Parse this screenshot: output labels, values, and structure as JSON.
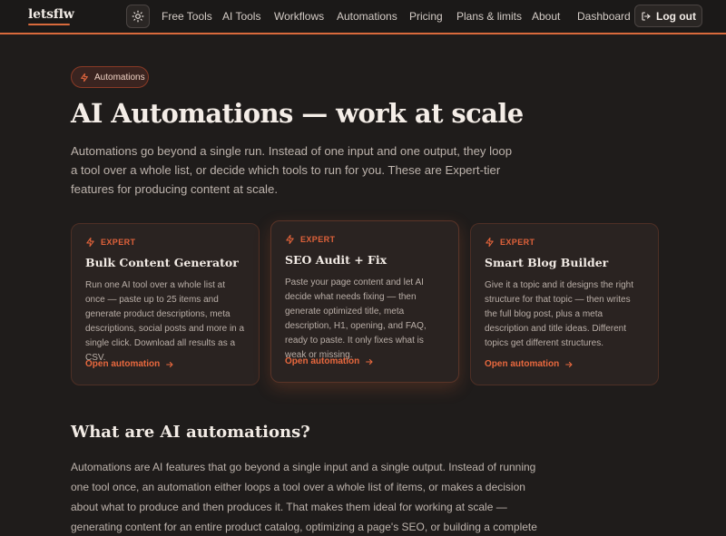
{
  "header": {
    "logo": "letsflw",
    "nav": [
      "Free Tools",
      "AI Tools",
      "Workflows",
      "Automations",
      "Pricing",
      "Plans & limits",
      "About",
      "Dashboard"
    ],
    "logout_label": "Log out"
  },
  "hero": {
    "badge": "Automations",
    "title": "AI Automations — work at scale",
    "lead": "Automations go beyond a single run. Instead of one input and one output, they loop a tool over a whole list, or decide which tools to run for you. These are Expert-tier features for producing content at scale."
  },
  "cards": [
    {
      "tag": "EXPERT",
      "title": "Bulk Content Generator",
      "text": "Run one AI tool over a whole list at once — paste up to 25 items and generate product descriptions, meta descriptions, social posts and more in a single click. Download all results as a CSV.",
      "link": "Open automation"
    },
    {
      "tag": "EXPERT",
      "title": "SEO Audit + Fix",
      "text": "Paste your page content and let AI decide what needs fixing — then generate optimized title, meta description, H1, opening, and FAQ, ready to paste. It only fixes what is weak or missing.",
      "link": "Open automation"
    },
    {
      "tag": "EXPERT",
      "title": "Smart Blog Builder",
      "text": "Give it a topic and it designs the right structure for that topic — then writes the full blog post, plus a meta description and title ideas. Different topics get different structures.",
      "link": "Open automation"
    }
  ],
  "section": {
    "title": "What are AI automations?",
    "body": "Automations are AI features that go beyond a single input and a single output. Instead of running one tool once, an automation either loops a tool over a whole list of items, or makes a decision about what to produce and then produces it. That makes them ideal for working at scale — generating content for an entire product catalog, optimizing a page's SEO, or building a complete blog post from a single topic."
  },
  "colors": {
    "accent": "#d96a3c",
    "background": "#1f1c1b"
  }
}
